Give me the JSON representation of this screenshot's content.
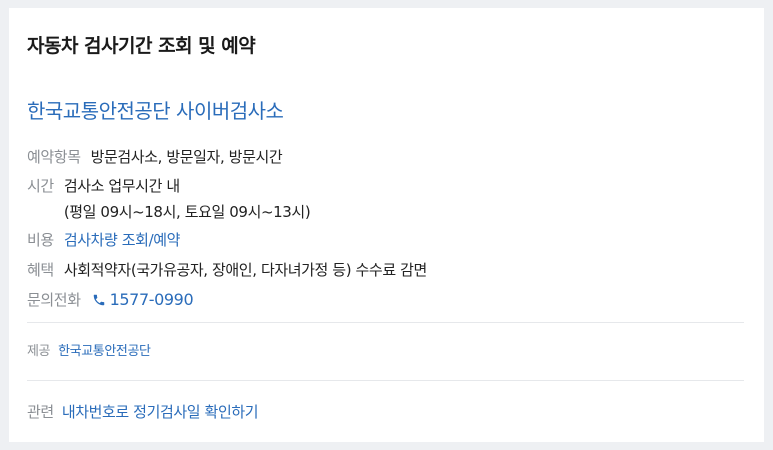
{
  "card": {
    "title": "자동차 검사기간 조회 및 예약",
    "org_name": "한국교통안전공단 사이버검사소",
    "rows": {
      "reservation": {
        "label": "예약항목",
        "value": "방문검사소, 방문일자, 방문시간"
      },
      "time": {
        "label": "시간",
        "line1": "검사소 업무시간 내",
        "line2": "(평일 09시~18시, 토요일 09시~13시)"
      },
      "cost": {
        "label": "비용",
        "link": "검사차량 조회/예약"
      },
      "benefit": {
        "label": "혜택",
        "value": "사회적약자(국가유공자, 장애인, 다자녀가정 등) 수수료 감면"
      },
      "phone": {
        "label": "문의전화",
        "number": "1577-0990",
        "icon": "phone-icon"
      }
    },
    "provider": {
      "label": "제공",
      "link": "한국교통안전공단"
    },
    "related": {
      "label": "관련",
      "link": "내차번호로 정기검사일 확인하기"
    }
  },
  "colors": {
    "link": "#2a6cba",
    "label": "#8b8f94",
    "text": "#222222",
    "background": "#eef0f3"
  }
}
